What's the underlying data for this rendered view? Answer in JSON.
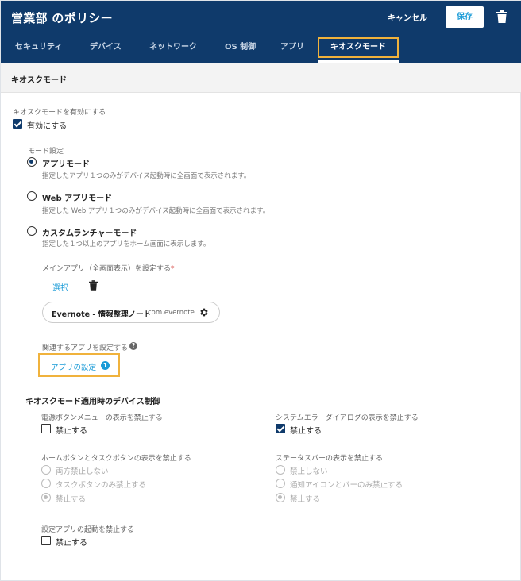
{
  "header": {
    "title": "営業部 のポリシー",
    "cancel_label": "キャンセル",
    "save_label": "保存"
  },
  "tabs": [
    {
      "label": "セキュリティ",
      "active": false
    },
    {
      "label": "デバイス",
      "active": false
    },
    {
      "label": "ネットワーク",
      "active": false
    },
    {
      "label": "OS 制御",
      "active": false
    },
    {
      "label": "アプリ",
      "active": false
    },
    {
      "label": "キオスクモード",
      "active": true
    }
  ],
  "section_title": "キオスクモード",
  "kiosk": {
    "enable_label": "キオスクモードを有効にする",
    "enable_checkbox_label": "有効にする",
    "enable_checked": true,
    "mode_label": "モード設定",
    "modes": [
      {
        "label": "アプリモード",
        "desc": "指定したアプリ１つのみがデバイス起動時に全画面で表示されます。",
        "selected": true
      },
      {
        "label": "Web アプリモード",
        "desc": "指定した Web アプリ１つのみがデバイス起動時に全画面で表示されます。",
        "selected": false
      },
      {
        "label": "カスタムランチャーモード",
        "desc": "指定した１つ以上のアプリをホーム画面に表示します。",
        "selected": false
      }
    ],
    "main_app_label": "メインアプリ（全画面表示）を設定する",
    "required_mark": "*",
    "select_label": "選択",
    "main_app": {
      "name": "Evernote - 情報整理ノート",
      "package": "com.evernote"
    },
    "related_label": "関連するアプリを設定する",
    "help_mark": "?",
    "app_settings_label": "アプリの設定",
    "app_settings_count": "1"
  },
  "device_control": {
    "title": "キオスクモード適用時のデバイス制御",
    "power_menu": {
      "label": "電源ボタンメニューの表示を禁止する",
      "checkbox": "禁止する",
      "checked": false
    },
    "system_error": {
      "label": "システムエラーダイアログの表示を禁止する",
      "checkbox": "禁止する",
      "checked": true
    },
    "home_task": {
      "label": "ホームボタンとタスクボタンの表示を禁止する",
      "options": [
        "両方禁止しない",
        "タスクボタンのみ禁止する",
        "禁止する"
      ],
      "selected_index": 2
    },
    "status_bar": {
      "label": "ステータスバーの表示を禁止する",
      "options": [
        "禁止しない",
        "通知アイコンとバーのみ禁止する",
        "禁止する"
      ],
      "selected_index": 2
    },
    "settings_app": {
      "label": "設定アプリの起動を禁止する",
      "checkbox": "禁止する",
      "checked": false
    }
  },
  "colors": {
    "header": "#0f3a6b",
    "accent": "#1a9bd7",
    "highlight": "#f0b23c"
  }
}
